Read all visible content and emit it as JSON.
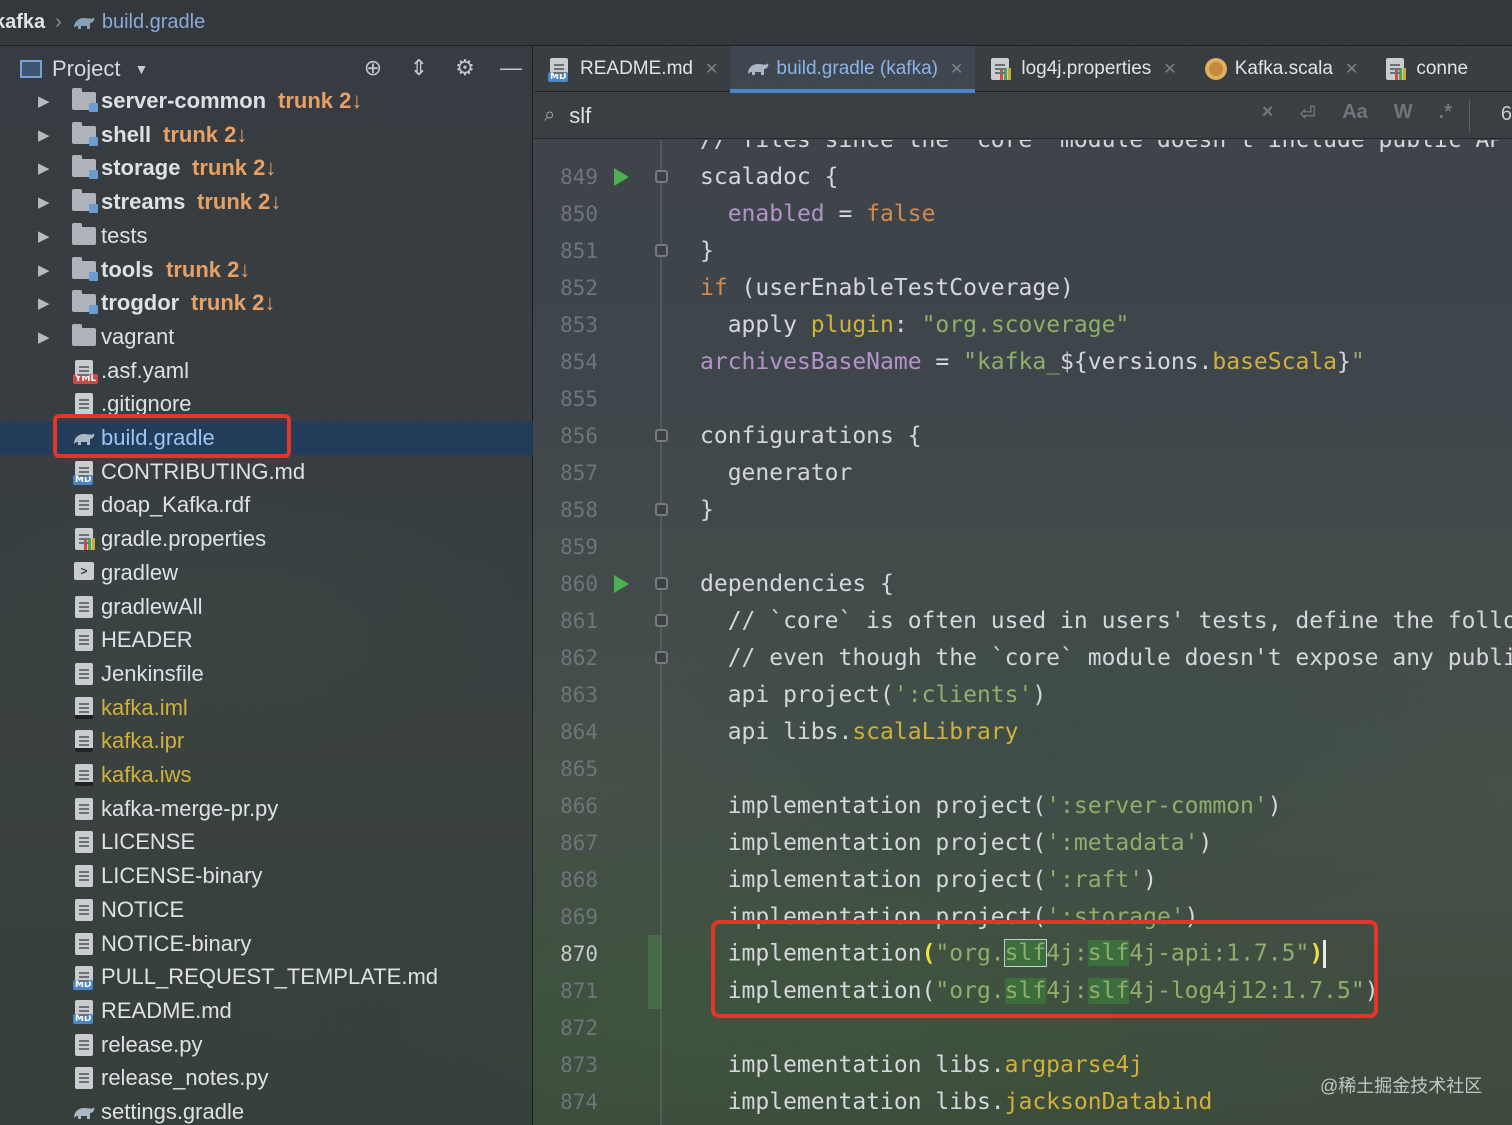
{
  "breadcrumb": {
    "root": "kafka",
    "file": "build.gradle"
  },
  "project_panel": {
    "title": "Project",
    "items": [
      {
        "label": "server-common",
        "vcs": "trunk 2↓",
        "type": "module",
        "expandable": true
      },
      {
        "label": "shell",
        "vcs": "trunk 2↓",
        "type": "module",
        "expandable": true
      },
      {
        "label": "storage",
        "vcs": "trunk 2↓",
        "type": "module",
        "expandable": true
      },
      {
        "label": "streams",
        "vcs": "trunk 2↓",
        "type": "module",
        "expandable": true
      },
      {
        "label": "tests",
        "vcs": "",
        "type": "folder",
        "expandable": true
      },
      {
        "label": "tools",
        "vcs": "trunk 2↓",
        "type": "module",
        "expandable": true
      },
      {
        "label": "trogdor",
        "vcs": "trunk 2↓",
        "type": "module",
        "expandable": true
      },
      {
        "label": "vagrant",
        "vcs": "",
        "type": "folder",
        "expandable": true
      },
      {
        "label": ".asf.yaml",
        "type": "yaml"
      },
      {
        "label": ".gitignore",
        "type": "text"
      },
      {
        "label": "build.gradle",
        "type": "gradle",
        "selected": true
      },
      {
        "label": "CONTRIBUTING.md",
        "type": "md"
      },
      {
        "label": "doap_Kafka.rdf",
        "type": "text"
      },
      {
        "label": "gradle.properties",
        "type": "props"
      },
      {
        "label": "gradlew",
        "type": "term"
      },
      {
        "label": "gradlewAll",
        "type": "text"
      },
      {
        "label": "HEADER",
        "type": "text"
      },
      {
        "label": "Jenkinsfile",
        "type": "text"
      },
      {
        "label": "kafka.iml",
        "type": "idea",
        "ignored": true
      },
      {
        "label": "kafka.ipr",
        "type": "idea",
        "ignored": true
      },
      {
        "label": "kafka.iws",
        "type": "idea",
        "ignored": true
      },
      {
        "label": "kafka-merge-pr.py",
        "type": "text"
      },
      {
        "label": "LICENSE",
        "type": "text"
      },
      {
        "label": "LICENSE-binary",
        "type": "text"
      },
      {
        "label": "NOTICE",
        "type": "text"
      },
      {
        "label": "NOTICE-binary",
        "type": "text"
      },
      {
        "label": "PULL_REQUEST_TEMPLATE.md",
        "type": "md"
      },
      {
        "label": "README.md",
        "type": "md"
      },
      {
        "label": "release.py",
        "type": "text"
      },
      {
        "label": "release_notes.py",
        "type": "text"
      },
      {
        "label": "settings.gradle",
        "type": "gradle"
      }
    ]
  },
  "tabs": [
    {
      "label": "README.md",
      "icon": "markdown-icon"
    },
    {
      "label": "build.gradle (kafka)",
      "icon": "gradle-icon",
      "active": true
    },
    {
      "label": "log4j.properties",
      "icon": "properties-icon"
    },
    {
      "label": "Kafka.scala",
      "icon": "scala-icon"
    },
    {
      "label": "conne",
      "icon": "properties-icon"
    }
  ],
  "search": {
    "query": "slf",
    "tools": [
      "×",
      "⏎",
      "Aa",
      "W",
      ".*"
    ],
    "count": "6"
  },
  "code": {
    "first_line": 849,
    "current_line": 870,
    "run_lines": [
      849,
      860
    ],
    "fold_lines": [
      849,
      851,
      856,
      858,
      860,
      861,
      862
    ],
    "changed_lines": [
      870,
      871
    ]
  },
  "watermark": "@稀土掘金技术社区",
  "colors": {
    "accent": "#4a88c7",
    "highlight_border": "#e5342a",
    "string": "#8fae6a",
    "keyword": "#d18a4a"
  }
}
